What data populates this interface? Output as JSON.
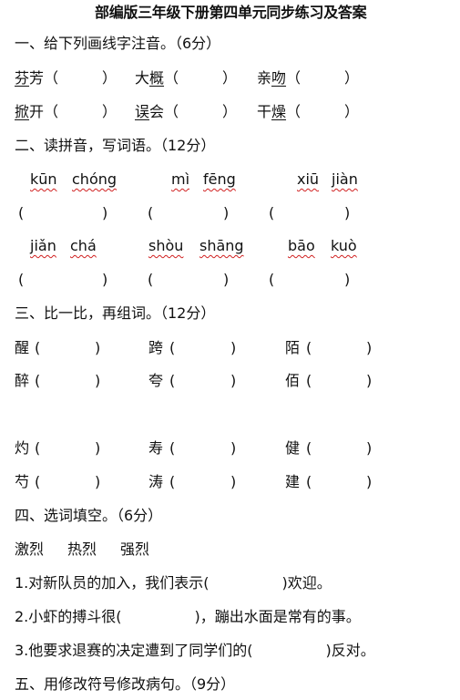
{
  "title": "部编版三年级下册第四单元同步练习及答案",
  "section1": {
    "heading": "一、给下列画线字注音。（6分）",
    "items": [
      {
        "pre": "",
        "u": "芬",
        "post": "芳（　　　）"
      },
      {
        "pre": "大",
        "u": "概",
        "post": "（　　　）"
      },
      {
        "pre": "亲",
        "u": "吻",
        "post": "（　　　）"
      },
      {
        "pre": "",
        "u": "掀",
        "post": "开（　　　）"
      },
      {
        "pre": "",
        "u": "误",
        "post": "会（　　　）"
      },
      {
        "pre": "干",
        "u": "燥",
        "post": "（　　　）"
      }
    ]
  },
  "section2": {
    "heading": "二、读拼音，写词语。（12分）",
    "pinyin": [
      [
        "kūn",
        "chóng"
      ],
      [
        "mì",
        "fēng"
      ],
      [
        "xiū",
        "jiàn"
      ],
      [
        "jiǎn",
        "chá"
      ],
      [
        "shòu",
        "shāng"
      ],
      [
        "bāo",
        "kuò"
      ]
    ],
    "blank": "(　　　　　　)"
  },
  "section3": {
    "heading": "三、比一比，再组词。（12分）",
    "chars": [
      "醒",
      "跨",
      "陌",
      "醉",
      "夸",
      "佰",
      "灼",
      "寿",
      "健",
      "芍",
      "涛",
      "建"
    ],
    "blank": "(　　　　)"
  },
  "section4": {
    "heading": "四、选词填空。（6分）",
    "options": [
      "激烈",
      "热烈",
      "强烈"
    ],
    "sentences": [
      "1.对新队员的加入，我们表示(　　　　　)欢迎。",
      "2.小虾的搏斗很(　　　　　)，蹦出水面是常有的事。",
      "3.他要求退赛的决定遭到了同学们的(　　　　　)反对。"
    ]
  },
  "section5": {
    "heading": "五、用修改符号修改病句。（9分）"
  }
}
